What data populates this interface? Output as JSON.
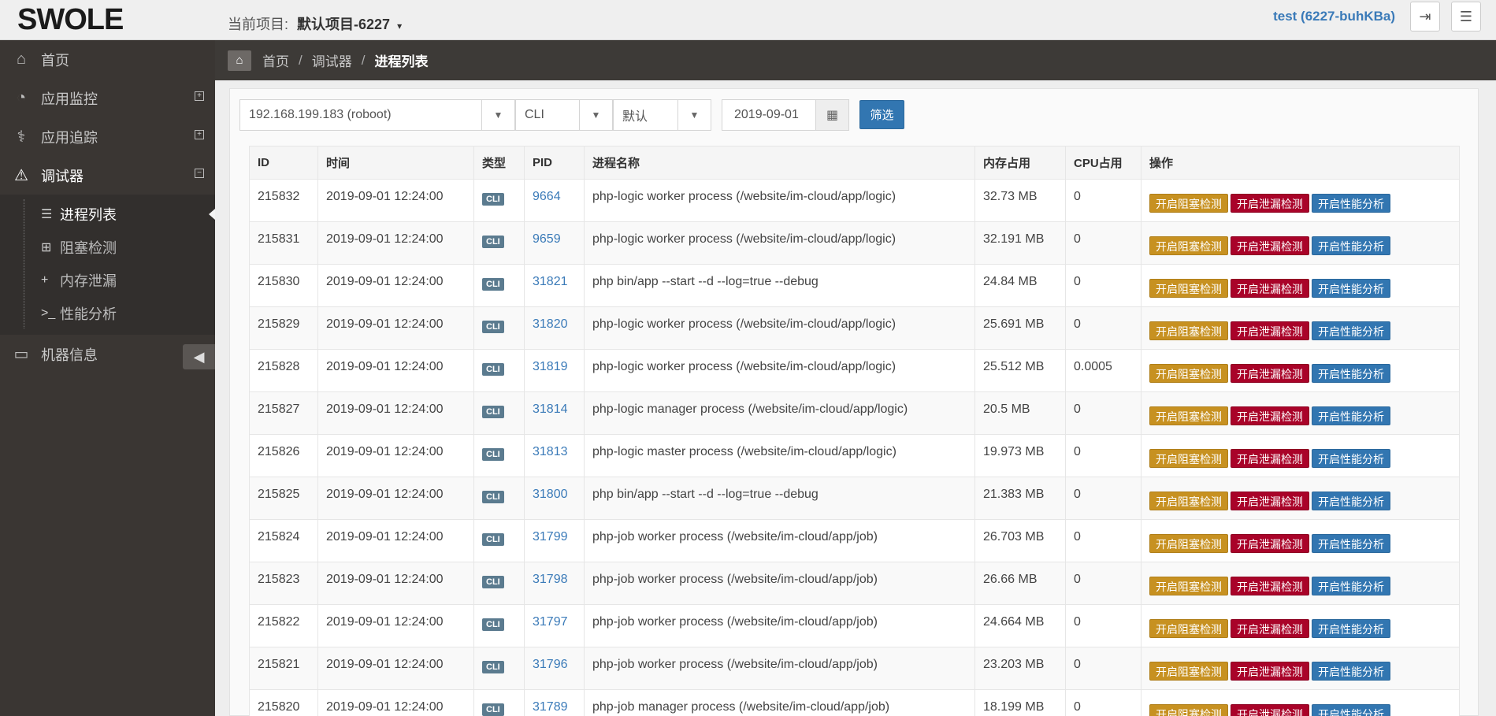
{
  "header": {
    "logo": "SWOLE",
    "project_label": "当前项目:",
    "project_value": "默认项目-6227",
    "user": "test (6227-buhKBa)"
  },
  "sidebar": {
    "items": [
      {
        "label": "首页",
        "icon": "home-icon"
      },
      {
        "label": "应用监控",
        "icon": "dashboard-icon"
      },
      {
        "label": "应用追踪",
        "icon": "stethoscope-icon"
      },
      {
        "label": "调试器",
        "icon": "warning-icon"
      },
      {
        "label": "机器信息",
        "icon": "desktop-icon"
      }
    ],
    "sub_items": [
      {
        "label": "进程列表",
        "icon": "list-icon"
      },
      {
        "label": "阻塞检测",
        "icon": "plus-square-icon"
      },
      {
        "label": "内存泄漏",
        "icon": "plus-icon"
      },
      {
        "label": "性能分析",
        "icon": "terminal-icon"
      }
    ]
  },
  "breadcrumb": {
    "items": [
      "首页",
      "调试器",
      "进程列表"
    ]
  },
  "filters": {
    "host": "192.168.199.183 (roboot)",
    "type": "CLI",
    "env": "默认",
    "date": "2019-09-01",
    "submit": "筛选"
  },
  "table": {
    "columns": [
      "ID",
      "时间",
      "类型",
      "PID",
      "进程名称",
      "内存占用",
      "CPU占用",
      "操作"
    ],
    "rows": [
      {
        "id": "215832",
        "time": "2019-09-01 12:24:00",
        "type": "CLI",
        "pid": "9664",
        "name": "php-logic worker process (/website/im-cloud/app/logic)",
        "mem": "32.73 MB",
        "cpu": "0"
      },
      {
        "id": "215831",
        "time": "2019-09-01 12:24:00",
        "type": "CLI",
        "pid": "9659",
        "name": "php-logic worker process (/website/im-cloud/app/logic)",
        "mem": "32.191 MB",
        "cpu": "0"
      },
      {
        "id": "215830",
        "time": "2019-09-01 12:24:00",
        "type": "CLI",
        "pid": "31821",
        "name": "php bin/app --start --d --log=true --debug",
        "mem": "24.84 MB",
        "cpu": "0"
      },
      {
        "id": "215829",
        "time": "2019-09-01 12:24:00",
        "type": "CLI",
        "pid": "31820",
        "name": "php-logic worker process (/website/im-cloud/app/logic)",
        "mem": "25.691 MB",
        "cpu": "0"
      },
      {
        "id": "215828",
        "time": "2019-09-01 12:24:00",
        "type": "CLI",
        "pid": "31819",
        "name": "php-logic worker process (/website/im-cloud/app/logic)",
        "mem": "25.512 MB",
        "cpu": "0.0005"
      },
      {
        "id": "215827",
        "time": "2019-09-01 12:24:00",
        "type": "CLI",
        "pid": "31814",
        "name": "php-logic manager process (/website/im-cloud/app/logic)",
        "mem": "20.5 MB",
        "cpu": "0"
      },
      {
        "id": "215826",
        "time": "2019-09-01 12:24:00",
        "type": "CLI",
        "pid": "31813",
        "name": "php-logic master process (/website/im-cloud/app/logic)",
        "mem": "19.973 MB",
        "cpu": "0"
      },
      {
        "id": "215825",
        "time": "2019-09-01 12:24:00",
        "type": "CLI",
        "pid": "31800",
        "name": "php bin/app --start --d --log=true --debug",
        "mem": "21.383 MB",
        "cpu": "0"
      },
      {
        "id": "215824",
        "time": "2019-09-01 12:24:00",
        "type": "CLI",
        "pid": "31799",
        "name": "php-job worker process (/website/im-cloud/app/job)",
        "mem": "26.703 MB",
        "cpu": "0"
      },
      {
        "id": "215823",
        "time": "2019-09-01 12:24:00",
        "type": "CLI",
        "pid": "31798",
        "name": "php-job worker process (/website/im-cloud/app/job)",
        "mem": "26.66 MB",
        "cpu": "0"
      },
      {
        "id": "215822",
        "time": "2019-09-01 12:24:00",
        "type": "CLI",
        "pid": "31797",
        "name": "php-job worker process (/website/im-cloud/app/job)",
        "mem": "24.664 MB",
        "cpu": "0"
      },
      {
        "id": "215821",
        "time": "2019-09-01 12:24:00",
        "type": "CLI",
        "pid": "31796",
        "name": "php-job worker process (/website/im-cloud/app/job)",
        "mem": "23.203 MB",
        "cpu": "0"
      },
      {
        "id": "215820",
        "time": "2019-09-01 12:24:00",
        "type": "CLI",
        "pid": "31789",
        "name": "php-job manager process (/website/im-cloud/app/job)",
        "mem": "18.199 MB",
        "cpu": "0"
      }
    ],
    "actions": {
      "block": "开启阻塞检测",
      "leak": "开启泄漏检测",
      "perf": "开启性能分析"
    }
  }
}
